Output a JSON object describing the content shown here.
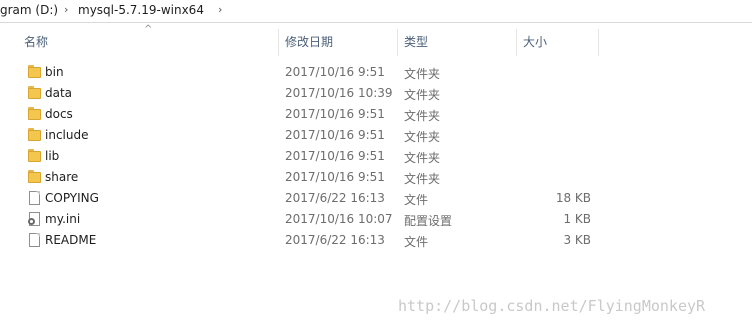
{
  "breadcrumb": [
    {
      "label": "gram (D:)"
    },
    {
      "label": "mysql-5.7.19-winx64"
    }
  ],
  "columns": {
    "name": "名称",
    "modified": "修改日期",
    "type": "类型",
    "size": "大小"
  },
  "files": [
    {
      "icon": "folder-icon",
      "name": "bin",
      "modified": "2017/10/16 9:51",
      "type": "文件夹",
      "size": ""
    },
    {
      "icon": "folder-icon",
      "name": "data",
      "modified": "2017/10/16 10:39",
      "type": "文件夹",
      "size": ""
    },
    {
      "icon": "folder-icon",
      "name": "docs",
      "modified": "2017/10/16 9:51",
      "type": "文件夹",
      "size": ""
    },
    {
      "icon": "folder-icon",
      "name": "include",
      "modified": "2017/10/16 9:51",
      "type": "文件夹",
      "size": ""
    },
    {
      "icon": "folder-icon",
      "name": "lib",
      "modified": "2017/10/16 9:51",
      "type": "文件夹",
      "size": ""
    },
    {
      "icon": "folder-icon",
      "name": "share",
      "modified": "2017/10/16 9:51",
      "type": "文件夹",
      "size": ""
    },
    {
      "icon": "file-icon",
      "name": "COPYING",
      "modified": "2017/6/22 16:13",
      "type": "文件",
      "size": "18 KB"
    },
    {
      "icon": "settings-file-icon",
      "name": "my.ini",
      "modified": "2017/10/16 10:07",
      "type": "配置设置",
      "size": "1 KB"
    },
    {
      "icon": "file-icon",
      "name": "README",
      "modified": "2017/6/22 16:13",
      "type": "文件",
      "size": "3 KB"
    }
  ],
  "watermark": "http://blog.csdn.net/FlyingMonkeyR",
  "colors": {
    "folder": "#f3c64d",
    "header_text": "#4c607a",
    "secondary_text": "#6d6d6d"
  }
}
